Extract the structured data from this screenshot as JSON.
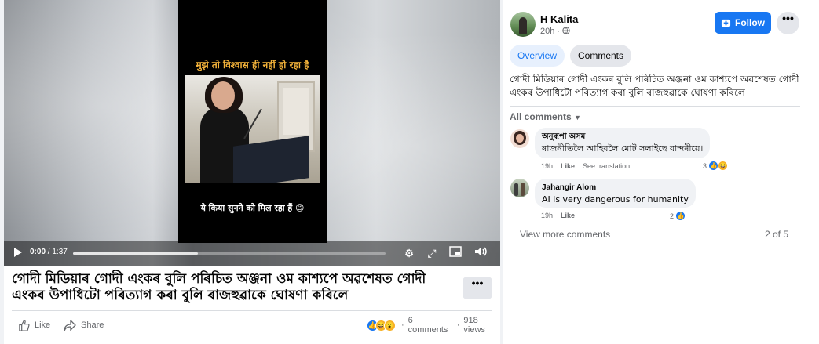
{
  "video": {
    "overlay_top": "मुझे तो विश्वास ही नहीं हो रहा है",
    "overlay_bottom": "ये किया सुनने को मिल रहा हैं 😊",
    "time_current": "0:00",
    "time_total": "/ 1:37",
    "progress": 0.4,
    "icons": [
      "play-icon",
      "settings-icon",
      "expand-icon",
      "miniplayer-icon",
      "volume-icon"
    ]
  },
  "post": {
    "title": "গোদী মিডিয়াৰ গোদী এংকৰ বুলি পৰিচিত অঞ্জনা ওম কাশ্যপে অৱশেষত গোদী এংকৰ উপাধিটো পৰিত্যাগ কৰা বুলি ৰাজহুৱাকে ঘোষণা কৰিলে",
    "more_label": "•••",
    "like_label": "Like",
    "share_label": "Share",
    "comments_count": "6 comments",
    "views": "918 views",
    "separator": "·"
  },
  "author": {
    "name": "H Kalita",
    "time": "20h",
    "privacy_icon": "globe-icon"
  },
  "header": {
    "follow_label": "Follow",
    "dots_label": "•••"
  },
  "tabs": [
    {
      "label": "Overview",
      "active": true
    },
    {
      "label": "Comments",
      "active": false
    }
  ],
  "caption": "গোদী মিডিয়াৰ গোদী এংকৰ বুলি পৰিচিত অঞ্জনা ওম কাশ্যপে অৱশেষত গোদী এংকৰ উপাধিটো পৰিত্যাগ কৰা বুলি ৰাজহুৱাকে ঘোষণা কৰিলে",
  "filter_label": "All comments",
  "comments": [
    {
      "name": "অনুৰূপা অসম",
      "text": "ৰাজনীতিলৈ আহিবলৈ মোট সলাইছে বান্দৰীয়ে।",
      "time": "19h",
      "like": "Like",
      "translate": "See translation",
      "reactions": "3"
    },
    {
      "name": "Jahangir Alom",
      "text": "AI is very dangerous for humanity",
      "time": "19h",
      "like": "Like",
      "reactions": "2"
    }
  ],
  "view_more": "View more comments",
  "pager": "2 of 5",
  "colors": {
    "accent": "#1877f2",
    "overlay_title": "#f4b33a",
    "background": "#f0f2f5"
  }
}
